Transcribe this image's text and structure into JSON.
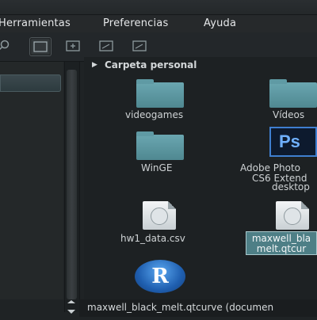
{
  "menubar": {
    "items": [
      "Herramientas",
      "Preferencias",
      "Ayuda"
    ]
  },
  "toolbar": {
    "buttons": [
      "search-icon",
      "icon-view-icon",
      "add-view-icon",
      "list-view-icon",
      "compact-view-icon"
    ]
  },
  "pathbar": {
    "label": "Carpeta personal"
  },
  "files": {
    "videogames": "videogames",
    "videos": "Vídeos",
    "winge": "WinGE",
    "adobe_line1": "Adobe Photo",
    "adobe_line2": "CS6 Extend",
    "adobe_line3": "desktop",
    "hw1": "hw1_data.csv",
    "maxwell_line1": "maxwell_bla",
    "maxwell_line2": "melt.qtcur"
  },
  "ps_icon_text": "Ps",
  "r_icon_text": "R",
  "status": {
    "text": "maxwell_black_melt.qtcurve (documen"
  },
  "colors": {
    "folder": "#5f9aa4",
    "selection": "#4e7f86"
  }
}
